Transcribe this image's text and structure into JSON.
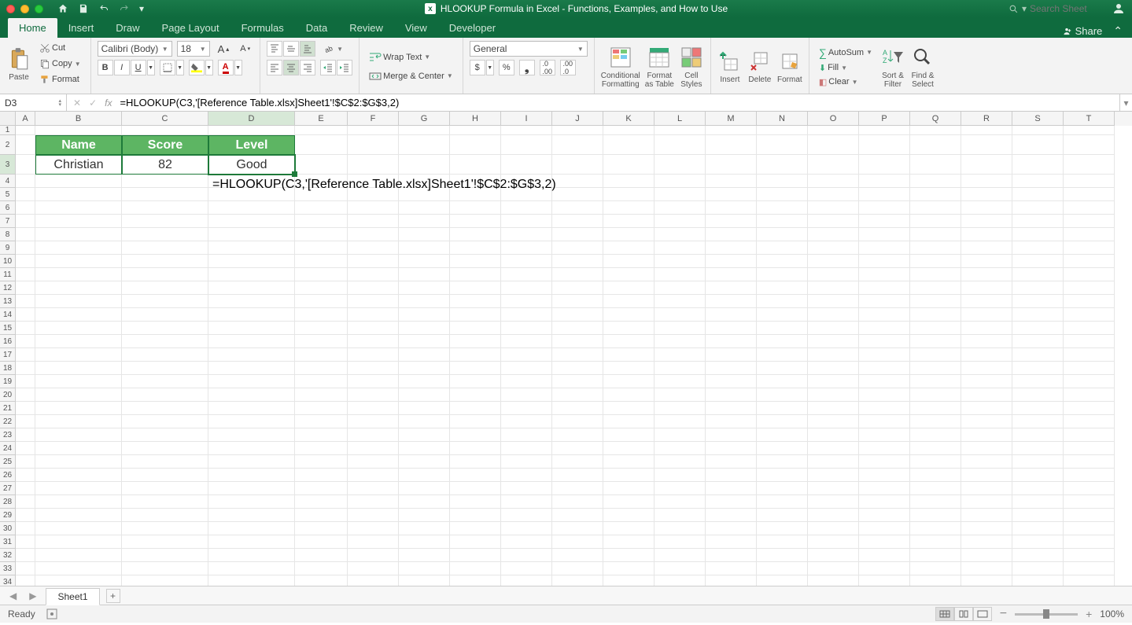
{
  "window": {
    "title": "HLOOKUP Formula in Excel - Functions, Examples, and How to Use"
  },
  "search": {
    "placeholder": "Search Sheet"
  },
  "tabs": {
    "items": [
      "Home",
      "Insert",
      "Draw",
      "Page Layout",
      "Formulas",
      "Data",
      "Review",
      "View",
      "Developer"
    ],
    "active": "Home",
    "share": "Share"
  },
  "ribbon": {
    "paste": "Paste",
    "cut": "Cut",
    "copy": "Copy",
    "format_painter": "Format",
    "font_name": "Calibri (Body)",
    "font_size": "18",
    "wrap": "Wrap Text",
    "merge": "Merge & Center",
    "number_format": "General",
    "cond_fmt": "Conditional\nFormatting",
    "fmt_table": "Format\nas Table",
    "cell_styles": "Cell\nStyles",
    "insert": "Insert",
    "delete": "Delete",
    "format": "Format",
    "autosum": "AutoSum",
    "fill": "Fill",
    "clear": "Clear",
    "sort": "Sort &\nFilter",
    "find": "Find &\nSelect"
  },
  "formula_bar": {
    "cell_ref": "D3",
    "formula": "=HLOOKUP(C3,'[Reference Table.xlsx]Sheet1'!$C$2:$G$3,2)"
  },
  "columns": [
    "A",
    "B",
    "C",
    "D",
    "E",
    "F",
    "G",
    "H",
    "I",
    "J",
    "K",
    "L",
    "M",
    "N",
    "O",
    "P",
    "Q",
    "R",
    "S",
    "T"
  ],
  "row_count": 37,
  "table": {
    "headers": [
      "Name",
      "Score",
      "Level"
    ],
    "row": [
      "Christian",
      "82",
      "Good"
    ]
  },
  "overlay_formula": "=HLOOKUP(C3,'[Reference Table.xlsx]Sheet1'!$C$2:$G$3,2)",
  "sheet": {
    "name": "Sheet1"
  },
  "status": {
    "ready": "Ready",
    "zoom": "100%"
  }
}
